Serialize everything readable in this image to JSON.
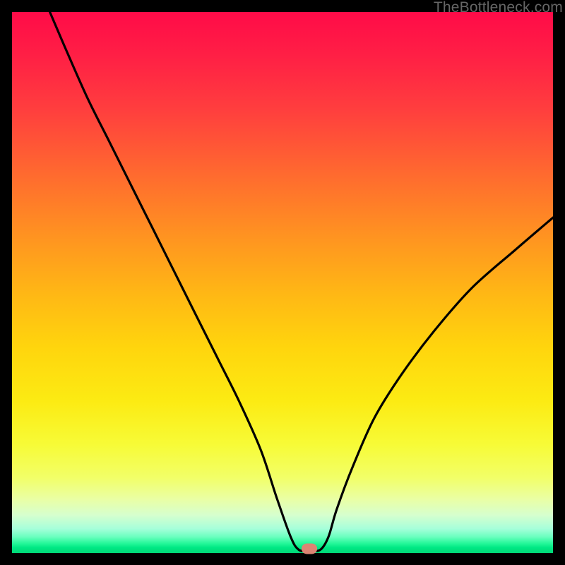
{
  "watermark": "TheBottleneck.com",
  "marker": {
    "x_pct": 55.0,
    "y_pct": 99.2
  },
  "colors": {
    "curve_stroke": "#000000",
    "marker_fill": "#dd8473",
    "frame_bg": "#000000"
  },
  "chart_data": {
    "type": "line",
    "title": "",
    "xlabel": "",
    "ylabel": "",
    "xlim": [
      0,
      100
    ],
    "ylim": [
      0,
      100
    ],
    "series": [
      {
        "name": "bottleneck-curve",
        "x": [
          7,
          10,
          14,
          18,
          22,
          26,
          30,
          34,
          38,
          42,
          46,
          49,
          51.5,
          53,
          55,
          57,
          58.5,
          60,
          63,
          67,
          72,
          78,
          85,
          93,
          100
        ],
        "y": [
          100,
          93,
          84,
          76,
          68,
          60,
          52,
          44,
          36,
          28,
          19,
          10,
          3,
          0.6,
          0.4,
          0.6,
          3,
          8,
          16,
          25,
          33,
          41,
          49,
          56,
          62
        ]
      }
    ],
    "marker_point": {
      "x": 55,
      "y": 0.8
    },
    "background_gradient": [
      {
        "pos": 0.0,
        "color": "#ff0b48"
      },
      {
        "pos": 0.3,
        "color": "#ff6a2f"
      },
      {
        "pos": 0.62,
        "color": "#ffd50d"
      },
      {
        "pos": 0.86,
        "color": "#f2ff67"
      },
      {
        "pos": 0.95,
        "color": "#a6ffda"
      },
      {
        "pos": 1.0,
        "color": "#00d977"
      }
    ]
  }
}
